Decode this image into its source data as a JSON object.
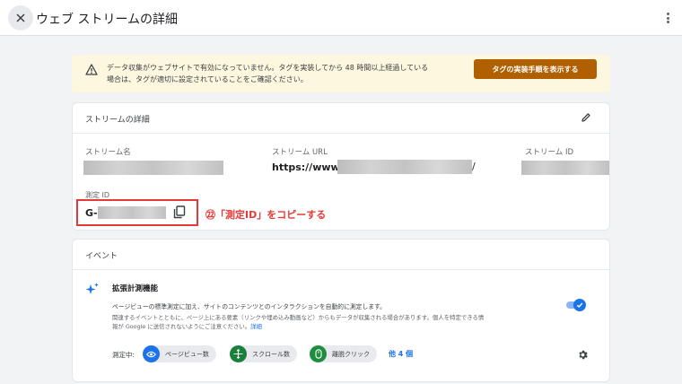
{
  "header": {
    "title": "ウェブ ストリームの詳細"
  },
  "banner": {
    "message_line1": "データ収集がウェブサイトで有効になっていません。タグを実装してから 48 時間以上経過している",
    "message_line2": "場合は、タグが適切に設定されていることをご確認ください。",
    "button_label": "タグの実装手順を表示する"
  },
  "stream_details": {
    "title": "ストリームの詳細",
    "stream_name_label": "ストリーム名",
    "stream_url_label": "ストリーム URL",
    "stream_url_prefix": "https://www.",
    "stream_url_suffix": "/",
    "stream_id_label": "ストリーム ID",
    "measurement_id_label": "測定 ID",
    "measurement_id_prefix": "G-",
    "annotation": "㉒「測定ID」をコピーする"
  },
  "events": {
    "title": "イベント",
    "enhanced_title": "拡張計測機能",
    "enhanced_desc": "ページビューの標準測定に加え、サイトのコンテンツとのインタラクションを自動的に測定します。",
    "enhanced_sub_1": "関連するイベントとともに、ページ上にある要素（リンクや埋め込み動画など）からもデータが収集される場合があります。個人を特定できる情",
    "enhanced_sub_2": "報が Google に送信されないようにご注意ください。",
    "detail_link": "詳細",
    "measuring_label": "測定中:",
    "chips": [
      {
        "label": "ページビュー数",
        "icon": "eye-icon",
        "color": "#1a73e8"
      },
      {
        "label": "スクロール数",
        "icon": "crosshair-icon",
        "color": "#188038"
      },
      {
        "label": "離脱クリック",
        "icon": "mouse-icon",
        "color": "#1e8e3e"
      }
    ],
    "more_link": "他 4 個"
  },
  "colors": {
    "accent": "#1a73e8",
    "banner_button": "#b06000",
    "highlight": "#e53935",
    "banner_bg": "#fef7e0"
  }
}
